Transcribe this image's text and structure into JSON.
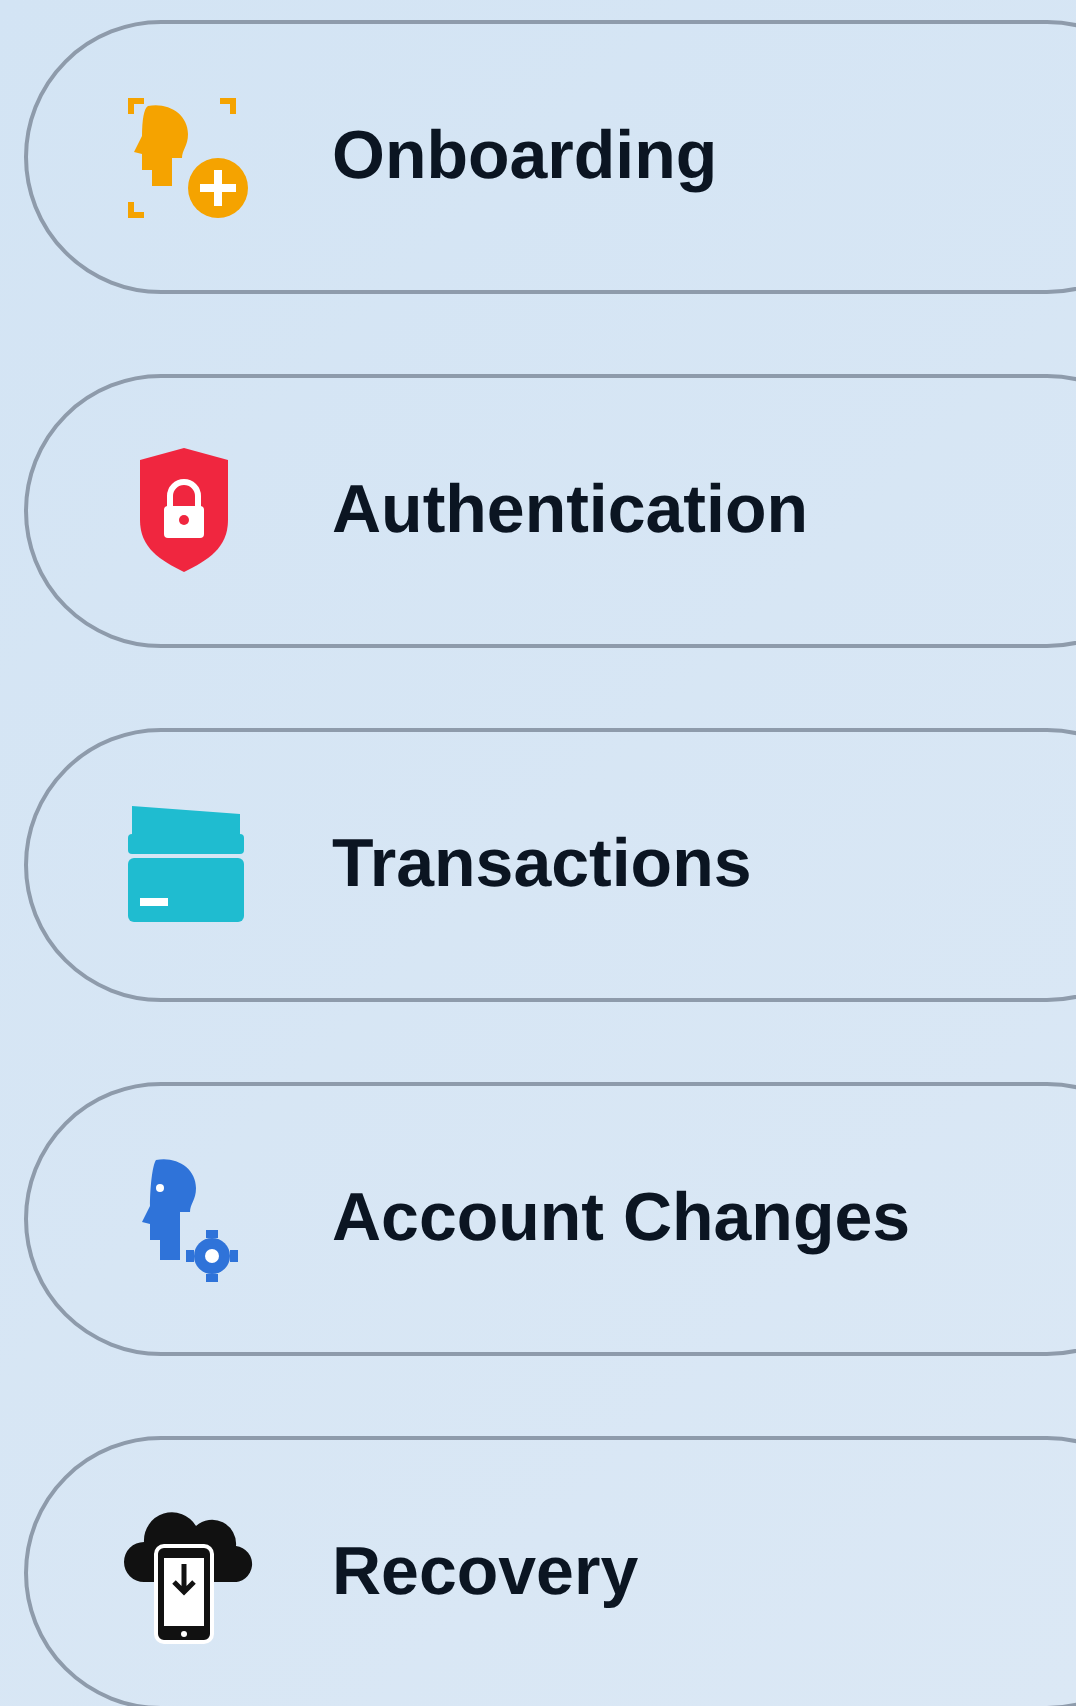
{
  "items": [
    {
      "label": "Onboarding",
      "kind": "person-plus",
      "color": "#f5a300"
    },
    {
      "label": "Authentication",
      "kind": "shield-lock",
      "color": "#f0263f"
    },
    {
      "label": "Transactions",
      "kind": "cards",
      "color": "#1fbcd0"
    },
    {
      "label": "Account Changes",
      "kind": "person-gear",
      "color": "#2f73d9"
    },
    {
      "label": "Recovery",
      "kind": "cloud-phone",
      "color": "#111111"
    }
  ]
}
